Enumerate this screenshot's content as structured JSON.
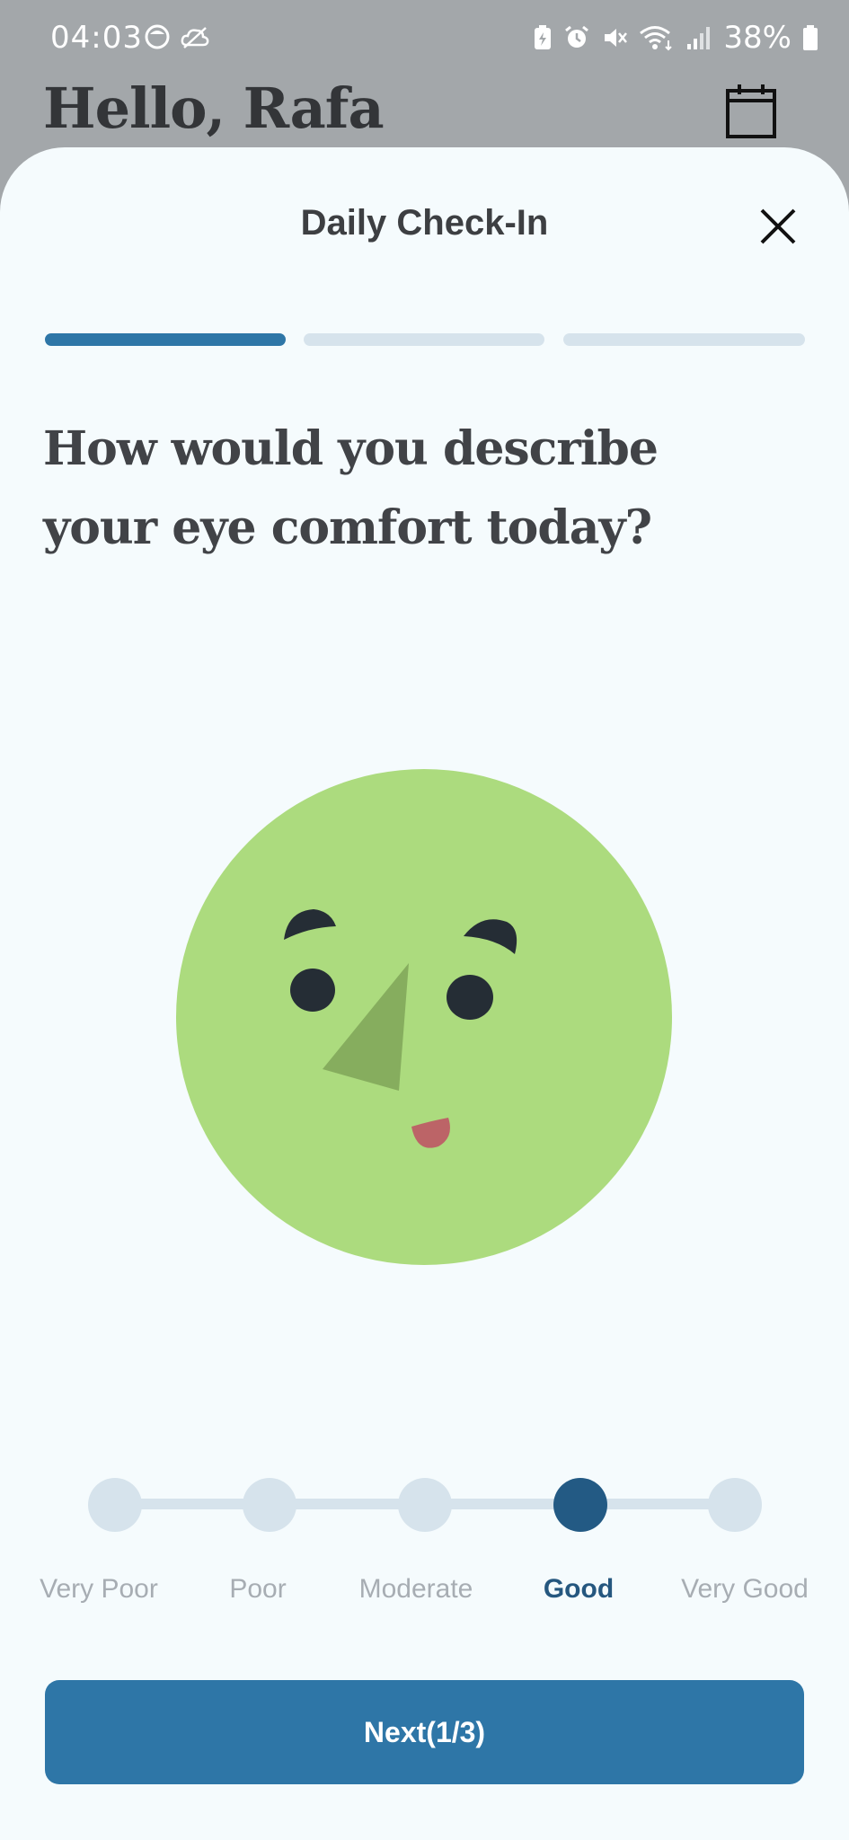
{
  "status_bar": {
    "time": "04:03",
    "battery": "38%",
    "icons": [
      "face-icon",
      "cloud-icon",
      "battery-saver-icon",
      "alarm-icon",
      "mute-icon",
      "wifi-icon",
      "signal-icon",
      "battery-icon"
    ]
  },
  "header": {
    "greeting": "Hello, Rafa",
    "calendar_icon": "calendar-icon"
  },
  "sheet": {
    "title": "Daily Check-In",
    "close_icon": "close-icon",
    "progress": {
      "current_step": 1,
      "total_steps": 3
    },
    "question": "How would you describe your eye comfort today?",
    "face_colors": {
      "skin": "#acdb7e",
      "nose": "#86ad5e",
      "eyes": "#252d35",
      "mouth": "#bc6467"
    },
    "rating": {
      "options": [
        "Very Poor",
        "Poor",
        "Moderate",
        "Good",
        "Very Good"
      ],
      "selected": "Good"
    },
    "next_button": "Next(1/3)"
  },
  "colors": {
    "accent": "#2e76a7",
    "selected": "#235a84",
    "inactive": "#d6e3ec",
    "background": "#f5fbfd"
  }
}
